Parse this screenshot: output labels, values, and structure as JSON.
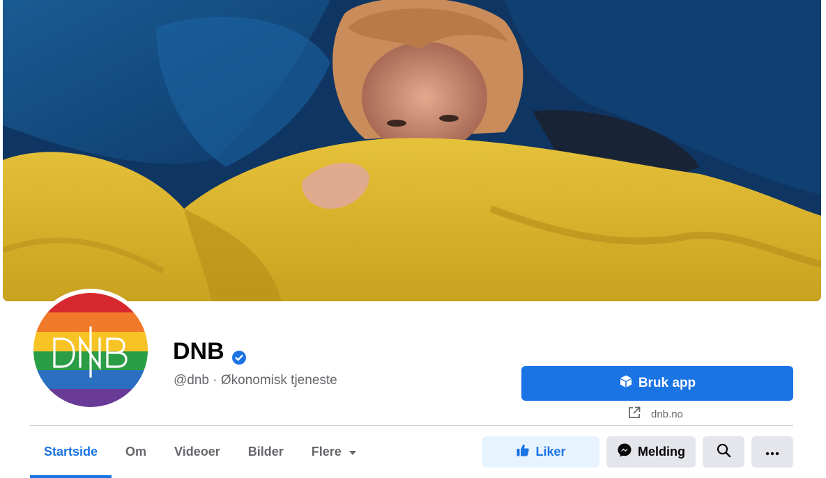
{
  "page": {
    "name": "DNB",
    "handle_category": "@dnb · Økonomisk tjeneste",
    "logo_text": "DNB"
  },
  "actions": {
    "primary_label": "Bruk app",
    "website": "dnb.no",
    "like_label": "Liker",
    "message_label": "Melding"
  },
  "tabs": [
    {
      "label": "Startside",
      "active": true
    },
    {
      "label": "Om",
      "active": false
    },
    {
      "label": "Videoer",
      "active": false
    },
    {
      "label": "Bilder",
      "active": false
    },
    {
      "label": "Flere",
      "active": false
    }
  ],
  "icons": {
    "verified": "verified-badge-icon",
    "primary": "cube-icon",
    "website": "external-link-icon",
    "like": "thumbs-up-icon",
    "message": "messenger-icon",
    "search": "search-icon",
    "more": "more-horizontal-icon",
    "dropdown": "caret-down-icon"
  },
  "colors": {
    "accent": "#1b74e4",
    "like_bg": "#e7f3ff",
    "secondary_bg": "#e4e6eb",
    "muted_text": "#65676b",
    "rainbow": [
      "#d7282f",
      "#f07a2a",
      "#f7c325",
      "#2a9d46",
      "#2b6fc1",
      "#6a3a97"
    ]
  }
}
